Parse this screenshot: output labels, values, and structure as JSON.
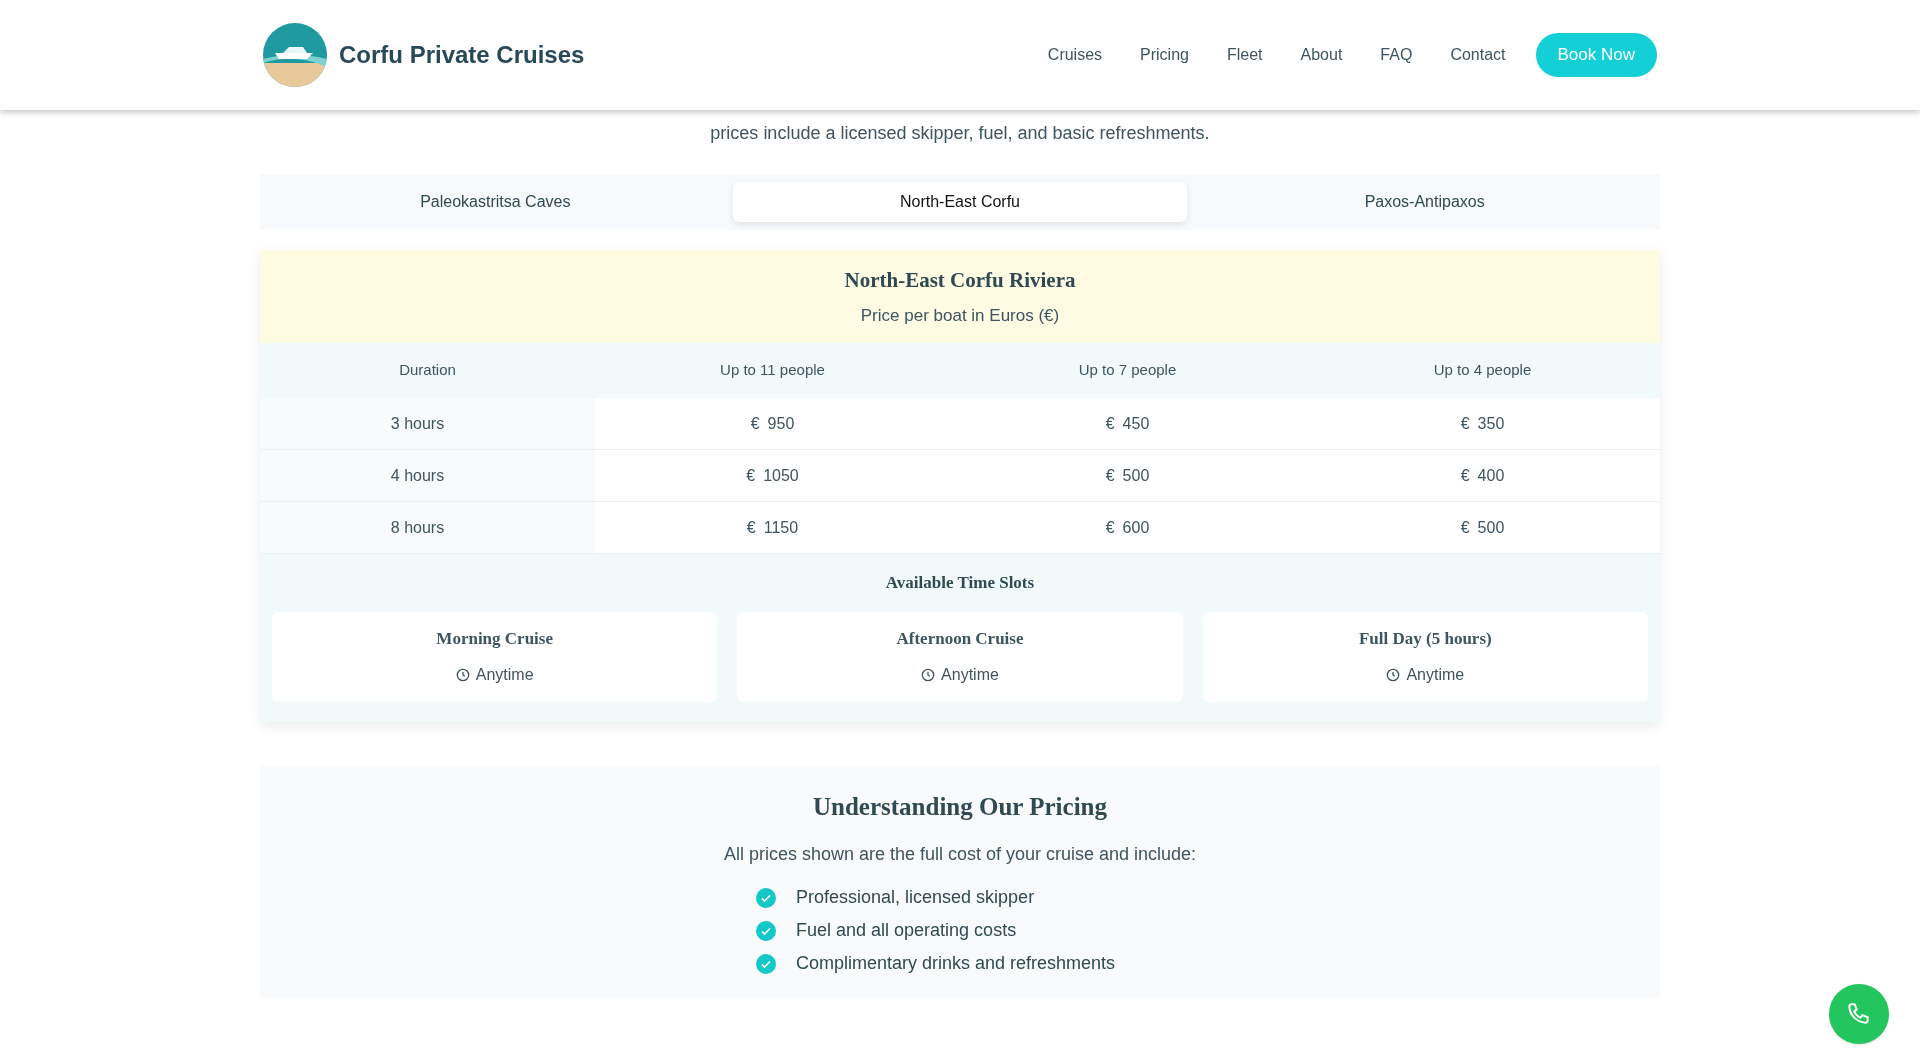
{
  "header": {
    "brand": "Corfu Private Cruises",
    "nav": [
      {
        "label": "Cruises"
      },
      {
        "label": "Pricing"
      },
      {
        "label": "Fleet"
      },
      {
        "label": "About"
      },
      {
        "label": "FAQ"
      },
      {
        "label": "Contact"
      }
    ],
    "cta": "Book Now"
  },
  "intro": [
    "prices include a licensed skipper, fuel, and basic refreshments."
  ],
  "tabs": [
    {
      "label": "Paleokastritsa Caves",
      "selected": false
    },
    {
      "label": "North-East Corfu",
      "selected": true
    },
    {
      "label": "Paxos-Antipaxos",
      "selected": false
    }
  ],
  "price_table": {
    "title": "North-East Corfu Riviera",
    "subtitle": "Price per boat in Euros (€)",
    "columns": [
      "Duration",
      "Up to 11 people",
      "Up to 7 people",
      "Up to 4 people"
    ],
    "rows": [
      {
        "duration": "3 hours",
        "prices": [
          "950",
          "450",
          "350"
        ]
      },
      {
        "duration": "4 hours",
        "prices": [
          "1050",
          "500",
          "400"
        ]
      },
      {
        "duration": "8 hours",
        "prices": [
          "1150",
          "600",
          "500"
        ]
      }
    ],
    "currency": "€"
  },
  "time_slots": {
    "title": "Available Time Slots",
    "slots": [
      {
        "name": "Morning Cruise",
        "time": "Anytime"
      },
      {
        "name": "Afternoon Cruise",
        "time": "Anytime"
      },
      {
        "name": "Full Day (5 hours)",
        "time": "Anytime"
      }
    ]
  },
  "understanding": {
    "title": "Understanding Our Pricing",
    "text": "All prices shown are the full cost of your cruise and include:",
    "items": [
      "Professional, licensed skipper",
      "Fuel and all operating costs",
      "Complimentary drinks and refreshments"
    ]
  }
}
